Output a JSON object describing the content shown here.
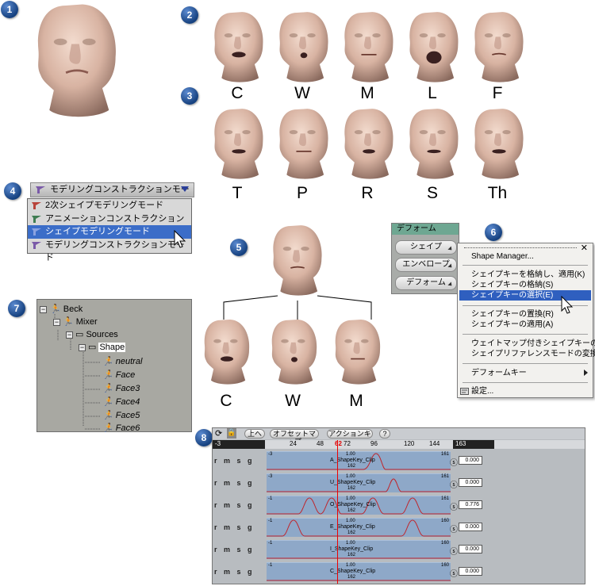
{
  "markers": [
    "1",
    "2",
    "3",
    "4",
    "5",
    "6",
    "7",
    "8"
  ],
  "visemes": {
    "row1": [
      "C",
      "W",
      "M",
      "L",
      "F"
    ],
    "row2": [
      "T",
      "P",
      "R",
      "S",
      "Th"
    ],
    "tree_labels": [
      "C",
      "W",
      "M"
    ]
  },
  "mode_menu": {
    "current": "モデリングコンストラクションモード",
    "items": [
      "2次シェイプモデリングモード",
      "アニメーションコンストラクションモード",
      "シェイプモデリングモード",
      "モデリングコンストラクションモード"
    ],
    "selected_index": 2,
    "icon_colors": [
      "#b8433a",
      "#3f7d52",
      "#5a78c8",
      "#7a5aa8"
    ]
  },
  "deform_panel": {
    "header": "デフォーム",
    "buttons": [
      "シェイプ",
      "エンベロープ",
      "デフォーム"
    ]
  },
  "context_menu": {
    "items": [
      {
        "label": "Shape Manager..."
      },
      {
        "label": "シェイプキーを格納し、適用(K)"
      },
      {
        "label": "シェイプキーの格納(S)"
      },
      {
        "label": "シェイプキーの選択(E)",
        "highlighted": true
      },
      {
        "label": "シェイプキーの置換(R)"
      },
      {
        "label": "シェイプキーの適用(A)"
      },
      {
        "label": "ウェイトマップ付きシェイプキーの調整"
      },
      {
        "label": "シェイプリファレンスモードの変換(V)..."
      },
      {
        "label": "デフォームキー"
      },
      {
        "label": "設定..."
      }
    ]
  },
  "explorer": {
    "nodes": [
      "Beck",
      "Mixer",
      "Sources",
      "Shape",
      "neutral",
      "Face",
      "Face3",
      "Face4",
      "Face5",
      "Face6"
    ]
  },
  "mixer": {
    "toolbar": {
      "up": "上へ",
      "offset_map": "オフセットマップ",
      "action_key": "アクションキー",
      "help": "?"
    },
    "range_start": "-3",
    "range_end": "163",
    "ruler_ticks": [
      "24",
      "48",
      "72",
      "96",
      "120",
      "144"
    ],
    "current_frame": "62",
    "track_controls": "r m s g",
    "tracks": [
      {
        "clip": "A_ShapeKey_Clip",
        "top": "1.00",
        "mid": "162",
        "left": "-3",
        "right": "161",
        "weight": "0.000"
      },
      {
        "clip": "U_ShapeKey_Clip",
        "top": "1.00",
        "mid": "162",
        "left": "-3",
        "right": "161",
        "weight": "0.000"
      },
      {
        "clip": "O_ShapeKey_Clip",
        "top": "1.00",
        "mid": "162",
        "left": "-1",
        "right": "161",
        "weight": "0.776"
      },
      {
        "clip": "E_ShapeKey_Clip",
        "top": "1.00",
        "mid": "162",
        "left": "-1",
        "right": "160",
        "weight": "0.000"
      },
      {
        "clip": "I_ShapeKey_Clip",
        "top": "1.00",
        "mid": "162",
        "left": "-1",
        "right": "160",
        "weight": "0.000"
      },
      {
        "clip": "C_ShapeKey_Clip",
        "top": "1.00",
        "mid": "162",
        "left": "-1",
        "right": "160",
        "weight": "0.000"
      }
    ]
  }
}
